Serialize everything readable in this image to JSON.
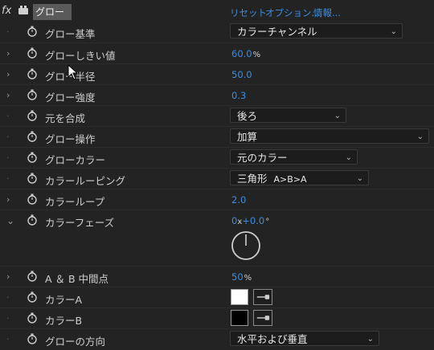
{
  "header": {
    "fx_label": "fx",
    "effect_name": "グロー",
    "reset_link": "リセット",
    "options_link": "オプション...",
    "info_link": "情報..."
  },
  "rows": {
    "glow_based_on": {
      "label": "グロー基準",
      "value": "カラーチャンネル"
    },
    "glow_threshold": {
      "label": "グローしきい値",
      "value": "60.0",
      "unit": "%"
    },
    "glow_radius": {
      "label": "グロー半径",
      "value": "50.0"
    },
    "glow_intensity": {
      "label": "グロー強度",
      "value": "0.3"
    },
    "composite_original": {
      "label": "元を合成",
      "value": "後ろ"
    },
    "glow_operation": {
      "label": "グロー操作",
      "value": "加算"
    },
    "glow_colors": {
      "label": "グローカラー",
      "value": "元のカラー"
    },
    "color_looping": {
      "label": "カラールーピング",
      "value": "三角形",
      "value_suffix": "A>B>A"
    },
    "color_loops": {
      "label": "カラーループ",
      "value": "2.0"
    },
    "color_phase": {
      "label": "カラーフェーズ",
      "value": "0",
      "x": "x",
      "value2": "+0.0",
      "deg": "°"
    },
    "ab_midpoint": {
      "label": "A ＆ B 中間点",
      "value": "50",
      "unit": "%"
    },
    "color_a": {
      "label": "カラーA",
      "color": "#ffffff"
    },
    "color_b": {
      "label": "カラーB",
      "color": "#000000"
    },
    "glow_dimensions": {
      "label": "グローの方向",
      "value": "水平および垂直"
    }
  },
  "colors": {
    "accent_blue": "#3d8ee0",
    "background": "#232323"
  },
  "icons": {
    "chevron": "chevron-down-icon",
    "twirl_closed": "›",
    "twirl_open": "⌄"
  }
}
